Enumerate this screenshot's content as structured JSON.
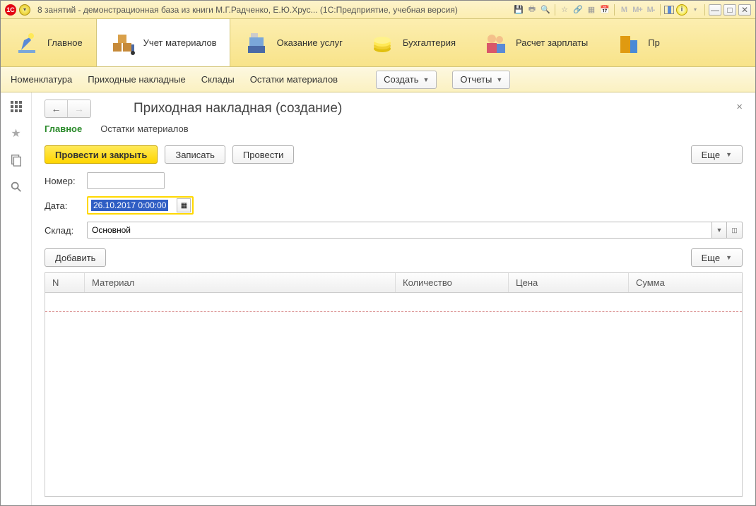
{
  "titlebar": {
    "logo_text": "1C",
    "title": "8 занятий - демонстрационная база из книги М.Г.Радченко, Е.Ю.Хрус...  (1С:Предприятие, учебная версия)"
  },
  "ribbon": [
    {
      "label": "Главное"
    },
    {
      "label": "Учет материалов"
    },
    {
      "label": "Оказание услуг"
    },
    {
      "label": "Бухгалтерия"
    },
    {
      "label": "Расчет зарплаты"
    },
    {
      "label": "Пр"
    }
  ],
  "cmdbar": {
    "links": [
      "Номенклатура",
      "Приходные накладные",
      "Склады",
      "Остатки материалов"
    ],
    "create": "Создать",
    "reports": "Отчеты"
  },
  "page": {
    "title": "Приходная накладная (создание)",
    "tabs": [
      "Главное",
      "Остатки материалов"
    ],
    "buttons": {
      "post_close": "Провести и закрыть",
      "save": "Записать",
      "post": "Провести",
      "more": "Еще"
    },
    "fields": {
      "number_label": "Номер:",
      "number_value": "",
      "date_label": "Дата:",
      "date_value": "26.10.2017  0:00:00",
      "warehouse_label": "Склад:",
      "warehouse_value": "Основной"
    },
    "table": {
      "add": "Добавить",
      "more": "Еще",
      "columns": [
        "N",
        "Материал",
        "Количество",
        "Цена",
        "Сумма"
      ]
    }
  }
}
